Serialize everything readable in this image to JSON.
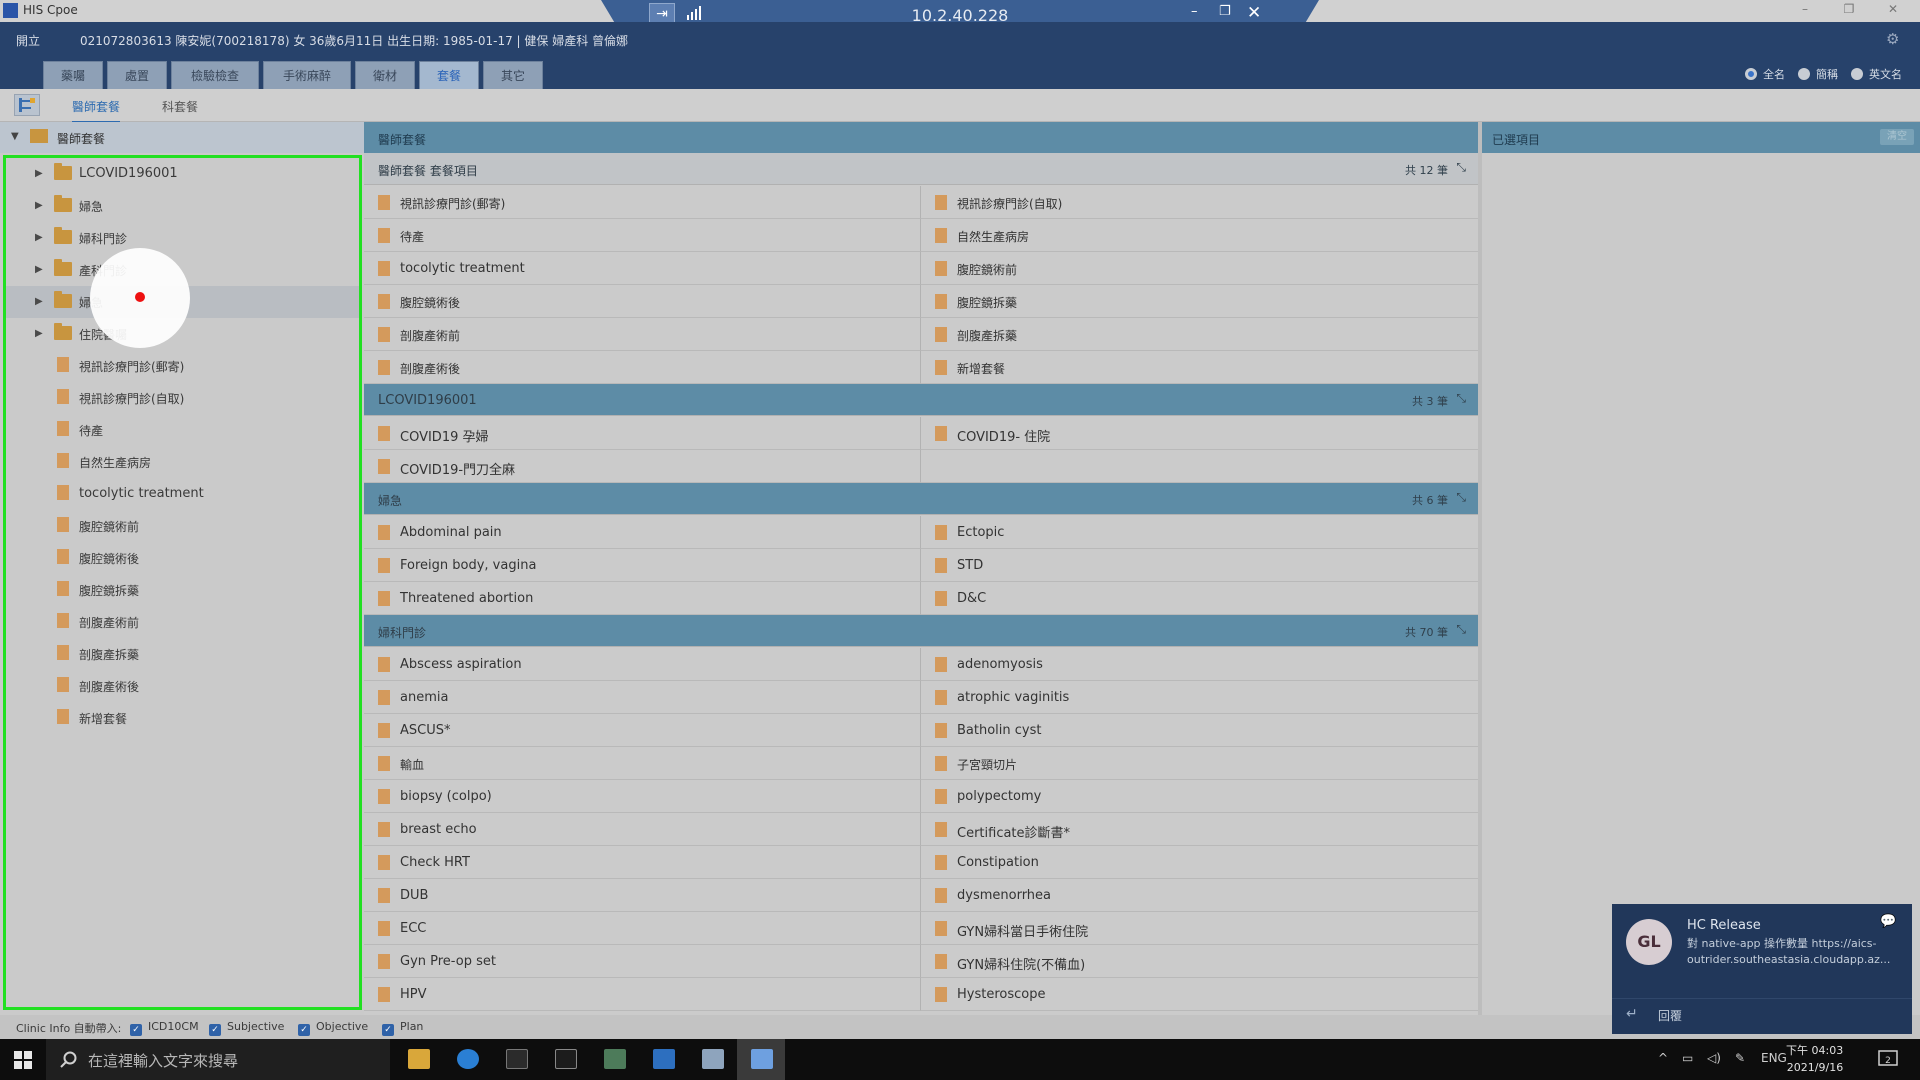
{
  "window": {
    "title": "HIS Cpoe"
  },
  "remote": {
    "ip": "10.2.40.228",
    "pin_label": "⇥",
    "min": "–",
    "restore": "❐",
    "close": "✕"
  },
  "header": {
    "order_label": "開立",
    "patient_info": "021072803613 陳安妮(700218178) 女 36歲6月11日 出生日期: 1985-01-17 | 健保 婦產科 曾倫娜",
    "tabs": [
      "藥囑",
      "處置",
      "檢驗檢查",
      "手術麻醉",
      "衛材",
      "套餐",
      "其它"
    ],
    "active_tab": "套餐",
    "name_options": [
      "全名",
      "簡稱",
      "英文名"
    ],
    "selected_name_option": "全名"
  },
  "subtabs": {
    "items": [
      "醫師套餐",
      "科套餐"
    ],
    "active": "醫師套餐"
  },
  "left_tree": {
    "root": "醫師套餐",
    "nodes": [
      {
        "label": "LCOVID196001",
        "type": "folder"
      },
      {
        "label": "婦急",
        "type": "folder"
      },
      {
        "label": "婦科門診",
        "type": "folder"
      },
      {
        "label": "產科門診",
        "type": "folder"
      },
      {
        "label": "婦急",
        "type": "folder",
        "selected": true
      },
      {
        "label": "住院醫囑",
        "type": "folder"
      },
      {
        "label": "視訊診療門診(郵寄)",
        "type": "item"
      },
      {
        "label": "視訊診療門診(自取)",
        "type": "item"
      },
      {
        "label": "待產",
        "type": "item"
      },
      {
        "label": "自然生產病房",
        "type": "item"
      },
      {
        "label": "tocolytic treatment",
        "type": "item"
      },
      {
        "label": "腹腔鏡術前",
        "type": "item"
      },
      {
        "label": "腹腔鏡術後",
        "type": "item"
      },
      {
        "label": "腹腔鏡拆藥",
        "type": "item"
      },
      {
        "label": "剖腹產術前",
        "type": "item"
      },
      {
        "label": "剖腹產拆藥",
        "type": "item"
      },
      {
        "label": "剖腹產術後",
        "type": "item"
      },
      {
        "label": "新增套餐",
        "type": "item"
      }
    ]
  },
  "middle": {
    "title": "醫師套餐",
    "sections": [
      {
        "title": "醫師套餐 套餐項目",
        "count": "共 12 筆",
        "items": [
          "視訊診療門診(郵寄)",
          "視訊診療門診(自取)",
          "待產",
          "自然生產病房",
          "tocolytic treatment",
          "腹腔鏡術前",
          "腹腔鏡術後",
          "腹腔鏡拆藥",
          "剖腹產術前",
          "剖腹產拆藥",
          "剖腹產術後",
          "新增套餐"
        ]
      },
      {
        "title": "LCOVID196001",
        "count": "共 3 筆",
        "items": [
          "COVID19 孕婦",
          "COVID19- 住院",
          "COVID19-門刀全麻"
        ]
      },
      {
        "title": "婦急",
        "count": "共 6 筆",
        "items": [
          "Abdominal pain",
          "Ectopic",
          "Foreign body, vagina",
          "STD",
          "Threatened abortion",
          "D&C"
        ]
      },
      {
        "title": "婦科門診",
        "count": "共 70 筆",
        "items": [
          "Abscess aspiration",
          "adenomyosis",
          "anemia",
          "atrophic vaginitis",
          "ASCUS*",
          "Batholin cyst",
          "輸血",
          "子宮頸切片",
          "biopsy (colpo)",
          "polypectomy",
          "breast echo",
          "Certificate診斷書*",
          "Check HRT",
          "Constipation",
          "DUB",
          "dysmenorrhea",
          "ECC",
          "GYN婦科當日手術住院",
          "Gyn Pre-op set",
          "GYN婦科住院(不備血)",
          "HPV",
          "Hysteroscope"
        ]
      }
    ]
  },
  "right": {
    "title": "已選項目",
    "button": "清空"
  },
  "footer": {
    "label": "Clinic Info 自動帶入:",
    "checks": [
      "ICD10CM",
      "Subjective",
      "Objective",
      "Plan"
    ]
  },
  "notification": {
    "avatar": "GL",
    "title": "HC Release",
    "body": "對 native-app 操作數量 https://aics-outrider.southeastasia.cloudapp.az...",
    "reply": "回覆"
  },
  "taskbar": {
    "search_placeholder": "在這裡輸入文字來搜尋",
    "lang": "ENG",
    "time": "下午 04:03",
    "date": "2021/9/16",
    "notif_count": "2"
  },
  "colors": {
    "header": "#27426b",
    "section_blue": "#5d8ca6",
    "highlight_border": "#22e022",
    "cursor_dot": "#ee1111"
  }
}
